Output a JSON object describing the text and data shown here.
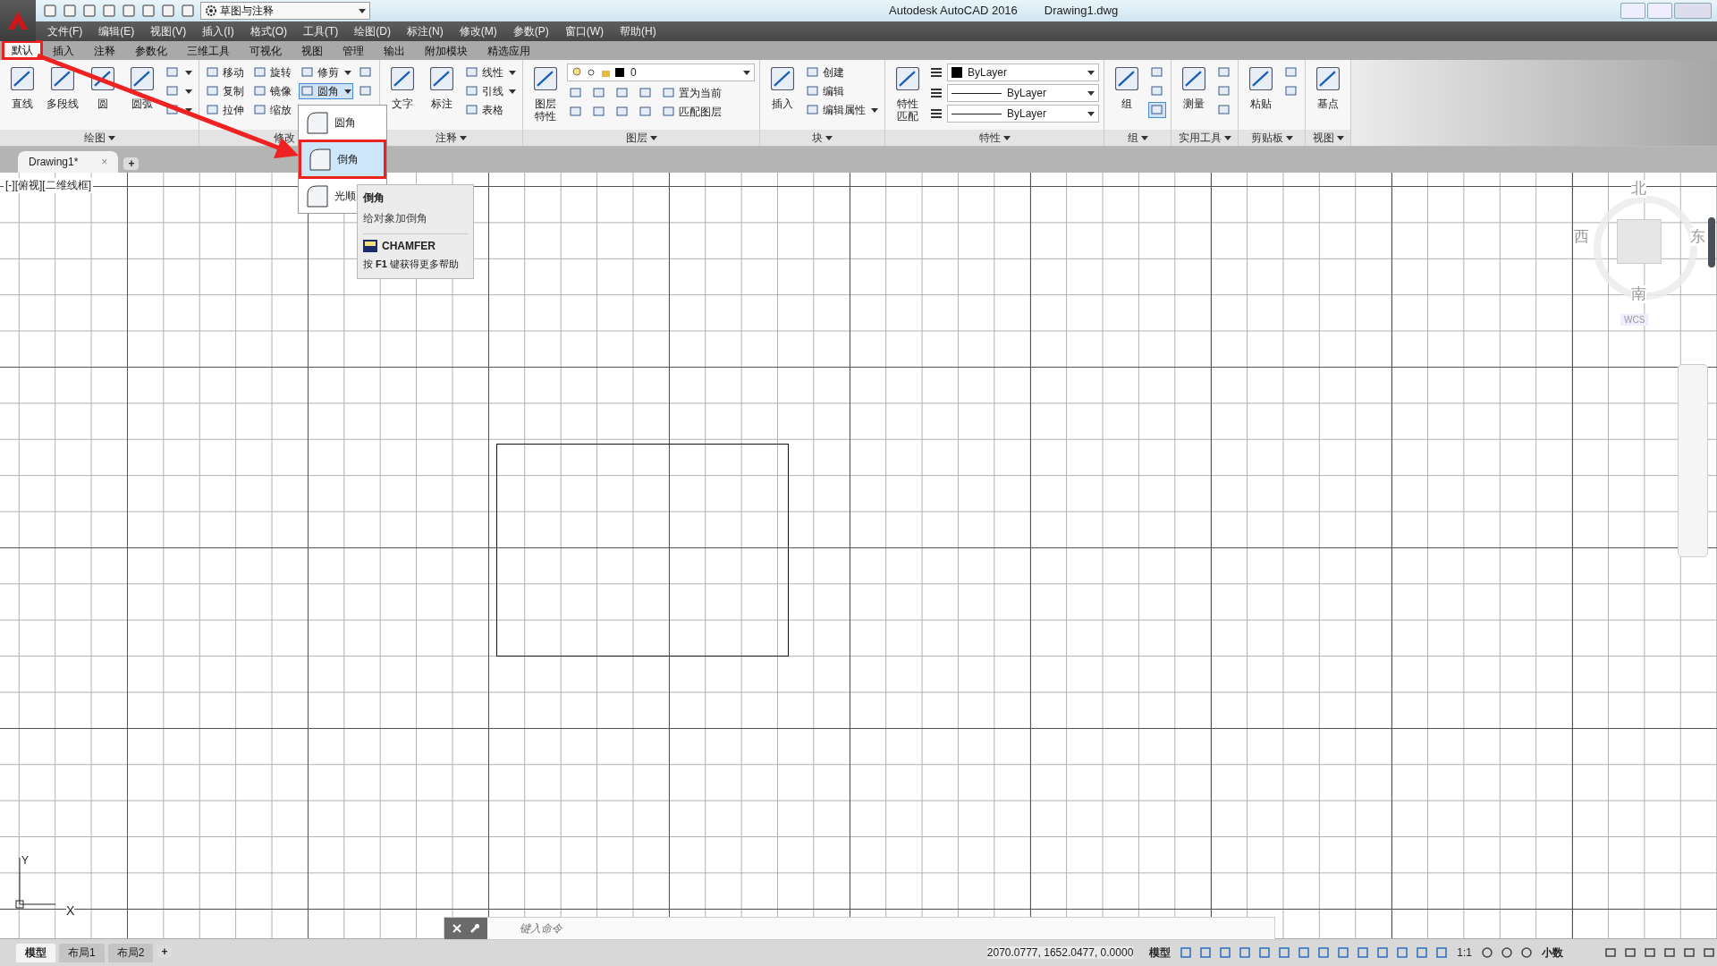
{
  "title_bar": {
    "workspace": "草图与注释",
    "title": "Autodesk AutoCAD 2016",
    "filename": "Drawing1.dwg"
  },
  "menu": [
    "文件(F)",
    "编辑(E)",
    "视图(V)",
    "插入(I)",
    "格式(O)",
    "工具(T)",
    "绘图(D)",
    "标注(N)",
    "修改(M)",
    "参数(P)",
    "窗口(W)",
    "帮助(H)"
  ],
  "ribbon_tabs": [
    {
      "label": "默认",
      "selected": true,
      "highlighted": true
    },
    {
      "label": "插入",
      "selected": false,
      "highlighted": false
    },
    {
      "label": "注释",
      "selected": false,
      "highlighted": false
    },
    {
      "label": "参数化",
      "selected": false,
      "highlighted": false
    },
    {
      "label": "三维工具",
      "selected": false,
      "highlighted": false
    },
    {
      "label": "可视化",
      "selected": false,
      "highlighted": false
    },
    {
      "label": "视图",
      "selected": false,
      "highlighted": false
    },
    {
      "label": "管理",
      "selected": false,
      "highlighted": false
    },
    {
      "label": "输出",
      "selected": false,
      "highlighted": false
    },
    {
      "label": "附加模块",
      "selected": false,
      "highlighted": false
    },
    {
      "label": "精选应用",
      "selected": false,
      "highlighted": false
    }
  ],
  "ribbon_panels": [
    {
      "title": "绘图",
      "large": [
        [
          "直线"
        ],
        [
          "多段线"
        ],
        [
          "圆"
        ],
        [
          "圆弧"
        ]
      ],
      "small": [
        {
          "dropdown": true
        },
        {
          "dropdown": true
        },
        {
          "dropdown": true
        }
      ]
    },
    {
      "title": "修改",
      "small": [
        {
          "label": "移动",
          "dropdown": false
        },
        {
          "label": "复制",
          "dropdown": false
        },
        {
          "label": "拉伸",
          "dropdown": false
        },
        {
          "label": "旋转",
          "dropdown": false
        },
        {
          "label": "镜像",
          "dropdown": false
        },
        {
          "label": "缩放",
          "dropdown": false
        },
        {
          "label": "修剪",
          "dropdown": true
        },
        {
          "label": "圆角",
          "dropdown": true,
          "pressed": true
        }
      ],
      "small_extra": [
        {
          "dropdown": false
        },
        {
          "dropdown": false
        }
      ]
    },
    {
      "title": "注释",
      "large": [
        [
          "文字"
        ],
        [
          "标注"
        ]
      ],
      "small": [
        {
          "label": "线性",
          "dropdown": true
        },
        {
          "label": "引线",
          "dropdown": true
        },
        {
          "label": "表格",
          "dropdown": false
        }
      ]
    },
    {
      "title": "图层",
      "large": [
        [
          "图层",
          "特性"
        ]
      ],
      "combo": "0",
      "small": [
        {
          "dropdown": false
        },
        {
          "dropdown": false
        },
        {
          "dropdown": false
        },
        {
          "dropdown": false
        },
        {
          "dropdown": false
        },
        {
          "dropdown": false
        },
        {
          "dropdown": false
        },
        {
          "dropdown": false
        },
        {
          "label": "置为当前",
          "dropdown": false
        },
        {
          "label": "匹配图层",
          "dropdown": false
        }
      ]
    },
    {
      "title": "块",
      "large": [
        [
          "插入"
        ]
      ],
      "small": [
        {
          "label": "创建",
          "dropdown": false
        },
        {
          "label": "编辑",
          "dropdown": false
        },
        {
          "label": "编辑属性",
          "dropdown": true
        }
      ]
    },
    {
      "title": "特性",
      "large": [
        [
          "特性",
          "匹配"
        ]
      ],
      "props": [
        "ByLayer",
        "ByLayer",
        "ByLayer"
      ]
    },
    {
      "title": "组",
      "large": [
        [
          "组"
        ]
      ],
      "small": [
        {
          "dropdown": false
        },
        {
          "dropdown": false
        },
        {
          "dropdown": false,
          "pressed": true
        }
      ]
    },
    {
      "title": "实用工具",
      "large": [
        [
          "测量"
        ]
      ],
      "small": [
        {
          "dropdown": false
        },
        {
          "dropdown": false
        },
        {
          "dropdown": false
        }
      ]
    },
    {
      "title": "剪贴板",
      "large": [
        [
          "粘贴"
        ]
      ],
      "small": [
        {
          "dropdown": false
        },
        {
          "dropdown": false
        }
      ]
    },
    {
      "title": "视图",
      "large": [
        [
          "基点"
        ]
      ]
    }
  ],
  "fillet_menu": [
    {
      "label": "圆角",
      "selected": false,
      "highlighted": false
    },
    {
      "label": "倒角",
      "selected": true,
      "highlighted": true
    },
    {
      "label": "光顺",
      "selected": false,
      "highlighted": false
    }
  ],
  "tooltip": {
    "title": "倒角",
    "description": "给对象加倒角",
    "command": "CHAMFER",
    "help": "按 **F1** 键获得更多帮助"
  },
  "document_tabs": [
    {
      "label": "Drawing1*",
      "close": "×"
    }
  ],
  "new_tab": "+",
  "viewport_label": "[-][俯视][二维线框]",
  "viewcube": {
    "north": "北",
    "west": "西",
    "east": "东",
    "south": "南",
    "ucs": "WCS"
  },
  "ucs_icon": {
    "x": "X",
    "y": "Y"
  },
  "command_line": {
    "placeholder": "键入命令"
  },
  "layout_tabs": [
    {
      "label": "模型",
      "selected": true
    },
    {
      "label": "布局1",
      "selected": false
    },
    {
      "label": "布局2",
      "selected": false
    }
  ],
  "new_layout": "+",
  "status_bar": {
    "coordinates": "2070.0777, 1652.0477, 0.0000",
    "space": "模型",
    "scale": "1:1",
    "units": "小数"
  }
}
